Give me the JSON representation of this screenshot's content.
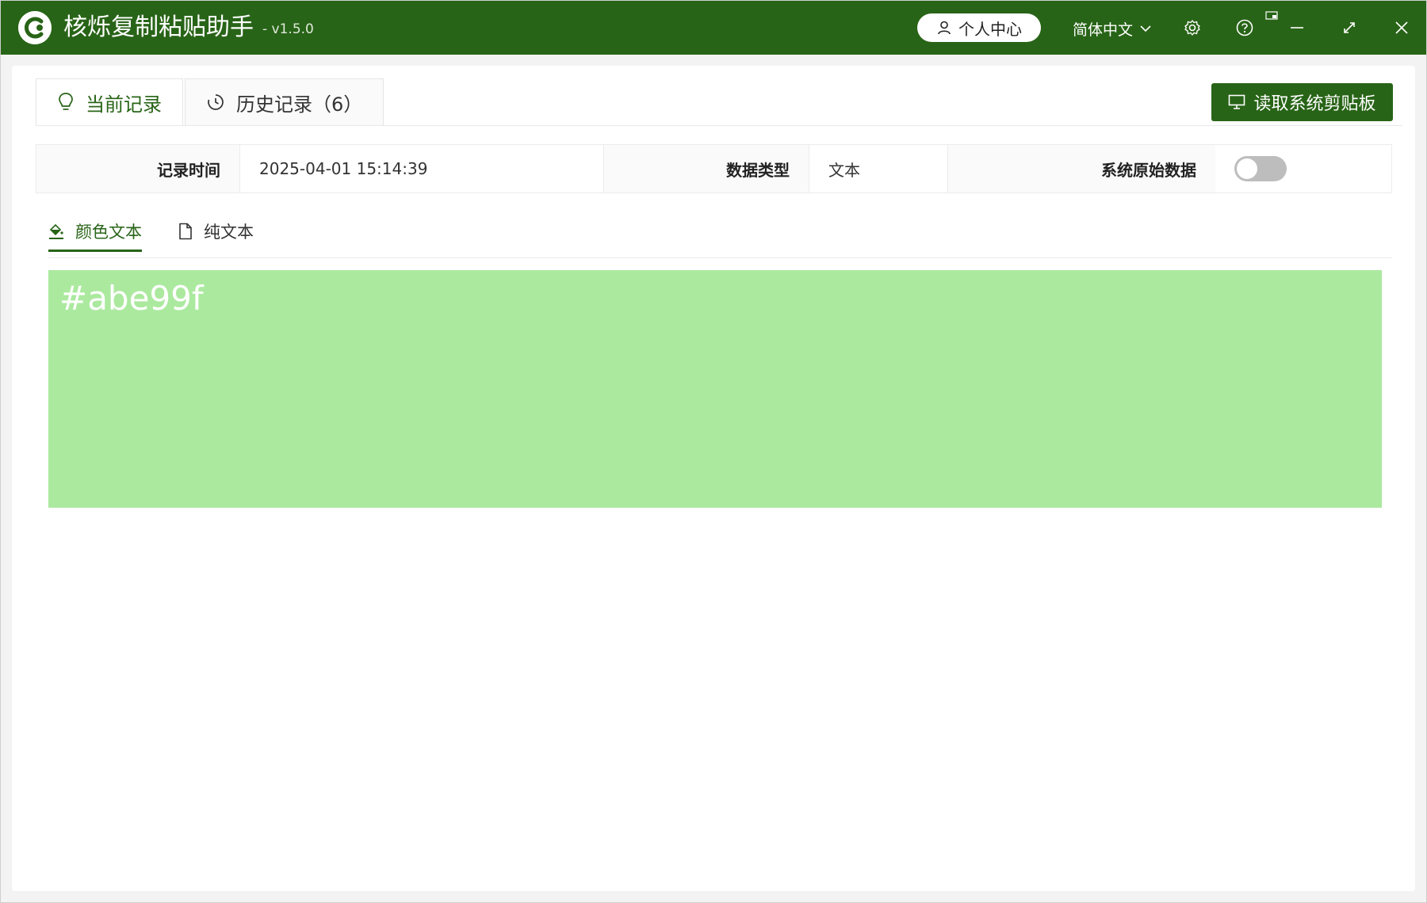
{
  "app": {
    "title": "核烁复制粘贴助手",
    "version": "- v1.5.0",
    "brand_color": "#286417"
  },
  "titlebar": {
    "profile_label": "个人中心",
    "language": "简体中文",
    "icons": [
      "user-icon",
      "chevron-down-icon",
      "gear-icon",
      "help-icon",
      "minimize-icon",
      "maximize-icon",
      "close-icon"
    ]
  },
  "tabs": [
    {
      "label": "当前记录",
      "icon": "lightbulb-icon",
      "active": true
    },
    {
      "label": "历史记录（6）",
      "icon": "history-icon",
      "active": false
    }
  ],
  "actions": {
    "read_clipboard": "读取系统剪贴板"
  },
  "info": {
    "time_label": "记录时间",
    "time_value": "2025-04-01 15:14:39",
    "type_label": "数据类型",
    "type_value": "文本",
    "raw_label": "系统原始数据",
    "raw_enabled": false
  },
  "subtabs": [
    {
      "label": "颜色文本",
      "icon": "paint-bucket-icon",
      "active": true
    },
    {
      "label": "纯文本",
      "icon": "document-icon",
      "active": false
    }
  ],
  "preview": {
    "text": "#abe99f",
    "color": "#abe99f"
  }
}
